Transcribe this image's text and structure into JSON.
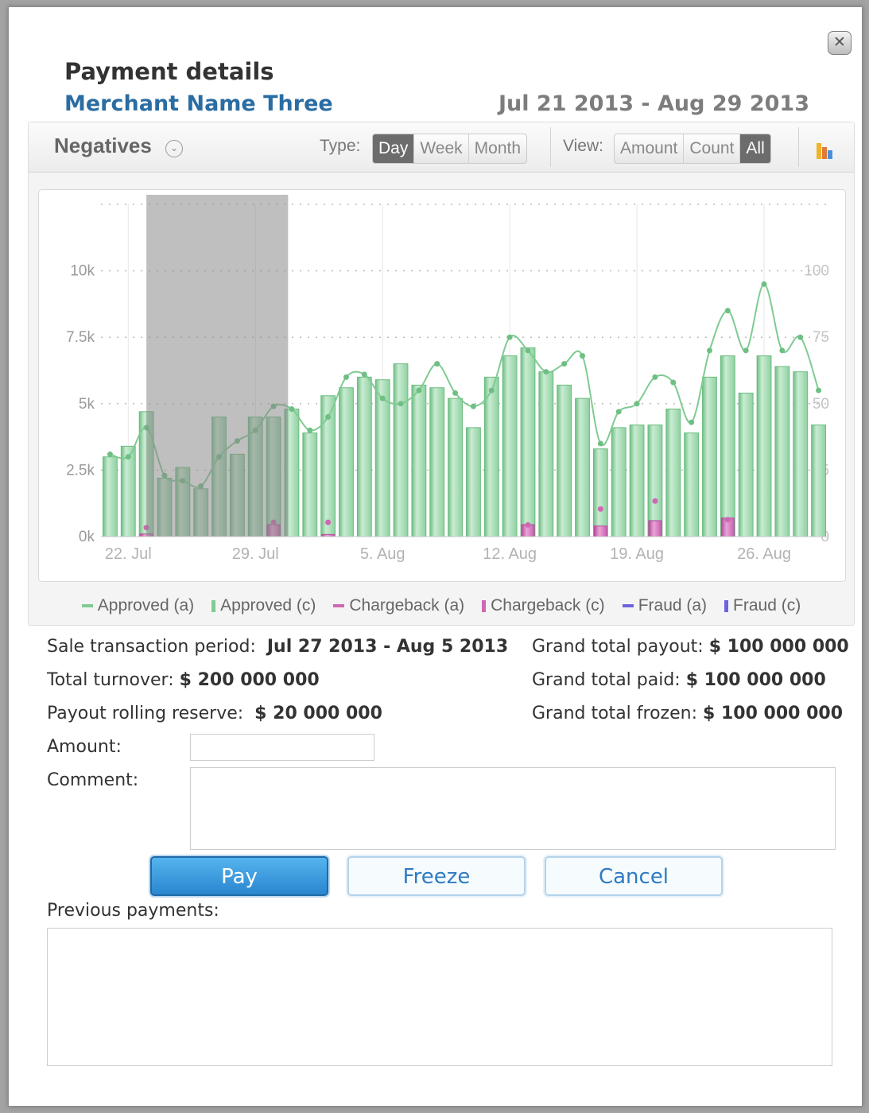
{
  "dialog": {
    "title": "Payment details",
    "merchant": "Merchant Name Three",
    "date_range": "Jul 21 2013 - Aug 29 2013",
    "close_glyph": "✕"
  },
  "toolbar": {
    "negatives_label": "Negatives",
    "dropdown_glyph": "⌄",
    "type_label": "Type:",
    "type_options": [
      "Day",
      "Week",
      "Month"
    ],
    "type_selected": "Day",
    "view_label": "View:",
    "view_options": [
      "Amount",
      "Count",
      "All"
    ],
    "view_selected": "All",
    "chart_type_icon": "bar-chart-icon"
  },
  "colors": {
    "approved": "#7fcb92",
    "chargeback": "#d067b4",
    "fraud": "#6d63e0",
    "selection": "#8a8a8a"
  },
  "chart_data": {
    "type": "bar",
    "y_left_ticks": [
      "0k",
      "2.5k",
      "5k",
      "7.5k",
      "10k"
    ],
    "y_left_range": [
      0,
      12500
    ],
    "y_right_ticks": [
      "0",
      "25",
      "50",
      "75",
      "100"
    ],
    "y_right_range": [
      0,
      125
    ],
    "x_ticks": [
      "22. Jul",
      "29. Jul",
      "5. Aug",
      "12. Aug",
      "19. Aug",
      "26. Aug"
    ],
    "x_tick_day_index": [
      1,
      8,
      15,
      22,
      29,
      36
    ],
    "days": 40,
    "selected_range": [
      2.5,
      10.3
    ],
    "series": [
      {
        "name": "Approved (c)",
        "kind": "bar",
        "values": [
          3000,
          3400,
          4700,
          2200,
          2600,
          1800,
          4500,
          3100,
          4500,
          4500,
          4800,
          3900,
          5300,
          5600,
          6000,
          5900,
          6500,
          5700,
          5600,
          5200,
          4100,
          6000,
          6800,
          7100,
          6200,
          5700,
          5200,
          3300,
          4100,
          4200,
          4200,
          4800,
          3900,
          6000,
          6800,
          5400,
          6800,
          6400,
          6200,
          4200
        ]
      },
      {
        "name": "Approved (a)",
        "kind": "line",
        "values": [
          31,
          30,
          41,
          23,
          21,
          19,
          30,
          36,
          40,
          49,
          48,
          40,
          45,
          60,
          61,
          52,
          50,
          55,
          65,
          54,
          49,
          55,
          75,
          70,
          62,
          65,
          68,
          35,
          47,
          50,
          60,
          58,
          43,
          70,
          85,
          70,
          95,
          70,
          75,
          55
        ]
      },
      {
        "name": "Chargeback (c)",
        "kind": "bar",
        "points": [
          [
            2,
            100
          ],
          [
            9,
            450
          ],
          [
            12,
            80
          ],
          [
            23,
            450
          ],
          [
            27,
            400
          ],
          [
            30,
            600
          ],
          [
            34,
            700
          ]
        ]
      },
      {
        "name": "Chargeback (a)",
        "kind": "dot",
        "points": [
          [
            2,
            1
          ],
          [
            9,
            3
          ],
          [
            12,
            3
          ],
          [
            23,
            2
          ],
          [
            27,
            8
          ],
          [
            30,
            11
          ],
          [
            34,
            4
          ]
        ]
      }
    ]
  },
  "legend": [
    {
      "label": "Approved (a)",
      "shape": "dash",
      "color": "#7fcb92"
    },
    {
      "label": "Approved (c)",
      "shape": "bar",
      "color": "#7fcb92"
    },
    {
      "label": "Chargeback (a)",
      "shape": "dash",
      "color": "#d067b4"
    },
    {
      "label": "Chargeback (c)",
      "shape": "bar",
      "color": "#d067b4"
    },
    {
      "label": "Fraud (a)",
      "shape": "dash",
      "color": "#6d63e0"
    },
    {
      "label": "Fraud (c)",
      "shape": "bar",
      "color": "#6d63e0"
    }
  ],
  "summary": {
    "sale_period_label": "Sale transaction period:",
    "sale_period_value": "Jul 27 2013 - Aug 5 2013",
    "turnover_label": "Total turnover:",
    "turnover_value": "$ 200 000 000",
    "reserve_label": "Payout rolling reserve:",
    "reserve_value": "$ 20 000 000",
    "payout_label": "Grand total payout:",
    "payout_value": "$ 100 000 000",
    "paid_label": "Grand total paid:",
    "paid_value": "$ 100 000 000",
    "frozen_label": "Grand total frozen:",
    "frozen_value": "$ 100 000 000"
  },
  "form": {
    "amount_label": "Amount:",
    "amount_value": "",
    "comment_label": "Comment:",
    "comment_value": "",
    "pay_label": "Pay",
    "freeze_label": "Freeze",
    "cancel_label": "Cancel",
    "previous_label": "Previous payments:"
  }
}
